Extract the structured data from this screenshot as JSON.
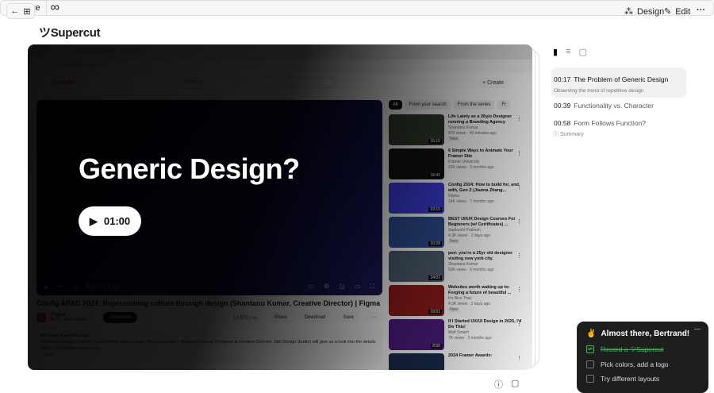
{
  "topbar": {
    "share": "Share",
    "design": "Design",
    "edit": "Edit",
    "more": "···"
  },
  "logo": "Supercut",
  "video": {
    "browser_tab": "Config APAC 2024 - YouTube",
    "address": "youtube.com/watch?v=...",
    "yt_logo": "YouTube",
    "search_placeholder": "Search",
    "create": "+ Create",
    "overlay_title": "Generic Design?",
    "play_time": "01:00",
    "current_time": "0:00 / 11:53",
    "title": "Config APAC 2024: Representing culture through design (Shantanu Kumar, Creative Director) | Figma",
    "channel": "Figma",
    "subscribers": "617K subscribers",
    "subscribe": "Subscribe",
    "likes": "571",
    "share": "Share",
    "download": "Download",
    "save": "Save",
    "desc_meta": "8K views  6 months ago",
    "description": "How does design influence culture? How does culture influence design? Shantanu Kumar (Designer & Creative Director, Skh Design Studio) will give us a look into the details of the craft behind great design.",
    "more": "...more",
    "chips": [
      "All",
      "From your search",
      "From the series",
      "Fr"
    ],
    "recs": [
      {
        "title": "Life Lately as a 26y/o Designer running a Branding Agency",
        "channel": "Shantanu Kumar",
        "meta": "875 views · 46 minutes ago",
        "badge": "New",
        "duration": "15:10",
        "color": "#2d3a2a"
      },
      {
        "title": "6 Simple Ways to Animate Your Framer Site",
        "channel": "Framer University",
        "meta": "31K views · 2 months ago",
        "badge": "",
        "duration": "16:41",
        "color": "#111111"
      },
      {
        "title": "Config 2024: How to build for, and with, Gen Z (Jiaona Zhang...",
        "channel": "Figma",
        "meta": "14K views · 7 months ago",
        "badge": "",
        "duration": "23:15",
        "color": "#3a3ad0"
      },
      {
        "title": "BEST UI/UX Design Courses For Beginners (w/ Certificates) ...",
        "channel": "Saptarshi Prakash",
        "meta": "4.3K views · 2 days ago",
        "badge": "New",
        "duration": "10:28",
        "color": "#2a4a8a"
      },
      {
        "title": "pov: you're a 25yr old designer visiting new york city.",
        "channel": "Shantanu Kumar",
        "meta": "63K views · 6 months ago",
        "badge": "",
        "duration": "14:01",
        "color": "#4a5a6a"
      },
      {
        "title": "Websites worth waking up to: Forging a future of beautiful ...",
        "channel": "It's Nice That",
        "meta": "4.3K views · 2 days ago",
        "badge": "New",
        "duration": "19:01",
        "color": "#8a1a1a"
      },
      {
        "title": "If I Started UX/UI Design in 2025, I'd Do This!",
        "channel": "Matt Smartt",
        "meta": "7K views · 3 months ago",
        "badge": "",
        "duration": "8:50",
        "color": "#4a1a7a"
      },
      {
        "title": "2024 Framer Awards:",
        "channel": "",
        "meta": "",
        "badge": "",
        "duration": "",
        "color": "#1a2a4a"
      }
    ]
  },
  "chapters": [
    {
      "time": "00:17",
      "title": "The Problem of Generic Design",
      "subtitle": "Observing the trend of repetitive design"
    },
    {
      "time": "00:39",
      "title": "Functionality vs. Character"
    },
    {
      "time": "00:58",
      "title": "Form Follows Function?"
    }
  ],
  "summary": "Summary",
  "toast": {
    "emoji": "✌️",
    "title": "Almost there, Bertrand!",
    "tasks": [
      {
        "label": "Record a ツSupercut",
        "done": true
      },
      {
        "label": "Pick colors, add a logo",
        "done": false
      },
      {
        "label": "Try different layouts",
        "done": false
      }
    ]
  }
}
